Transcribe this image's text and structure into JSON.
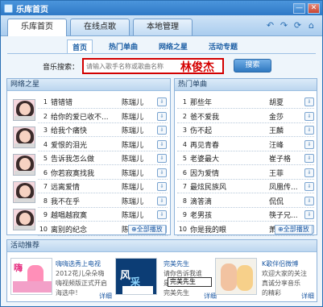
{
  "window": {
    "title": "乐库首页",
    "controls": {
      "minimize": "—",
      "close": "✕"
    }
  },
  "tabs": [
    "乐库首页",
    "在线点歌",
    "本地管理"
  ],
  "subtabs": [
    "首页",
    "热门单曲",
    "网络之星",
    "活动专题"
  ],
  "search": {
    "label": "音乐搜索：",
    "placeholder": "请输入歌手名称或歌曲名称",
    "overlay": "林俊杰",
    "button": "搜索"
  },
  "panels": {
    "left_title": "网络之星",
    "right_title": "热门单曲",
    "play_all": "全部播放"
  },
  "network_stars": [
    {
      "rank": "1",
      "song": "错错错",
      "artist": "陈瑞儿"
    },
    {
      "rank": "2",
      "song": "给你的爱已收不...",
      "artist": "陈瑞儿"
    },
    {
      "rank": "3",
      "song": "给我个痛快",
      "artist": "陈瑞儿"
    },
    {
      "rank": "4",
      "song": "爱恨的泪光",
      "artist": "陈瑞儿"
    },
    {
      "rank": "5",
      "song": "告诉我怎么做",
      "artist": "陈瑞儿"
    },
    {
      "rank": "6",
      "song": "你若寂寞找我",
      "artist": "陈瑞儿"
    },
    {
      "rank": "7",
      "song": "远离爱情",
      "artist": "陈瑞儿"
    },
    {
      "rank": "8",
      "song": "我不在乎",
      "artist": "陈瑞儿"
    },
    {
      "rank": "9",
      "song": "越唱越寂寞",
      "artist": "陈瑞儿"
    },
    {
      "rank": "10",
      "song": "离别的纪念",
      "artist": "陈瑞儿"
    }
  ],
  "hot_singles": [
    {
      "rank": "1",
      "song": "那些年",
      "artist": "胡夏"
    },
    {
      "rank": "2",
      "song": "爸不爱我",
      "artist": "金莎"
    },
    {
      "rank": "3",
      "song": "伤不起",
      "artist": "王麟"
    },
    {
      "rank": "4",
      "song": "再见青春",
      "artist": "汪峰"
    },
    {
      "rank": "5",
      "song": "老婆最大",
      "artist": "崔子格"
    },
    {
      "rank": "6",
      "song": "因为爱情",
      "artist": "王菲"
    },
    {
      "rank": "7",
      "song": "最炫民族风",
      "artist": "凤凰传..."
    },
    {
      "rank": "8",
      "song": "滴答滴",
      "artist": "侃侃"
    },
    {
      "rank": "9",
      "song": "老男孩",
      "artist": "筷子兄..."
    },
    {
      "rank": "10",
      "song": "你是我的眼",
      "artist": "萧煌奇"
    }
  ],
  "activity": {
    "title": "活动推荐",
    "items": [
      {
        "title": "嗨嗨选秀上电视",
        "desc": [
          "2012花儿朵朵嗨",
          "嗨视频版正式开启",
          "海选中！"
        ],
        "link": "详细"
      },
      {
        "title": "完美先生",
        "desc": [
          "请你告诉我谁",
          "是心中真正的",
          "完美先生"
        ],
        "link": "详细"
      },
      {
        "title": "K歌伴侣微博",
        "desc": [
          "欢迎大家的关注",
          "真诚分享音乐",
          "的精彩"
        ],
        "link": "详细"
      }
    ],
    "tooltip": "完美先生"
  },
  "colors": {
    "brand": "#2f79c6",
    "highlight": "#d40000",
    "link": "#1a57a2"
  },
  "icons": {
    "back": "back-arrow-icon",
    "forward": "forward-arrow-icon",
    "refresh": "refresh-icon",
    "home": "home-icon",
    "download": "download-icon"
  }
}
